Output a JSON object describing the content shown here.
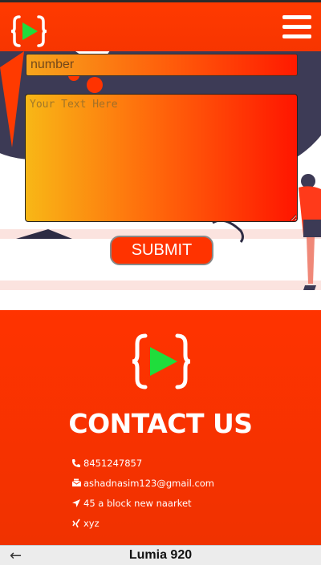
{
  "navbar": {
    "logo_icon": "code-play-logo-icon",
    "menu_icon": "hamburger-menu-icon"
  },
  "form": {
    "number_placeholder": "number",
    "text_placeholder": "Your Text Here",
    "submit_label": "SUBMIT"
  },
  "contact": {
    "title": "CONTACT US",
    "items": [
      {
        "icon": "phone-icon",
        "text": "8451247857"
      },
      {
        "icon": "email-icon",
        "text": "ashadnasim123@gmail.com"
      },
      {
        "icon": "location-icon",
        "text": "45 a block new naarket"
      },
      {
        "icon": "xing-icon",
        "text": "xyz"
      }
    ]
  },
  "device_bar": {
    "back_symbol": "←",
    "device_name": "Lumia 920"
  },
  "colors": {
    "brand": "#ff3300",
    "play_green": "#1fdd3c",
    "white": "#ffffff"
  }
}
